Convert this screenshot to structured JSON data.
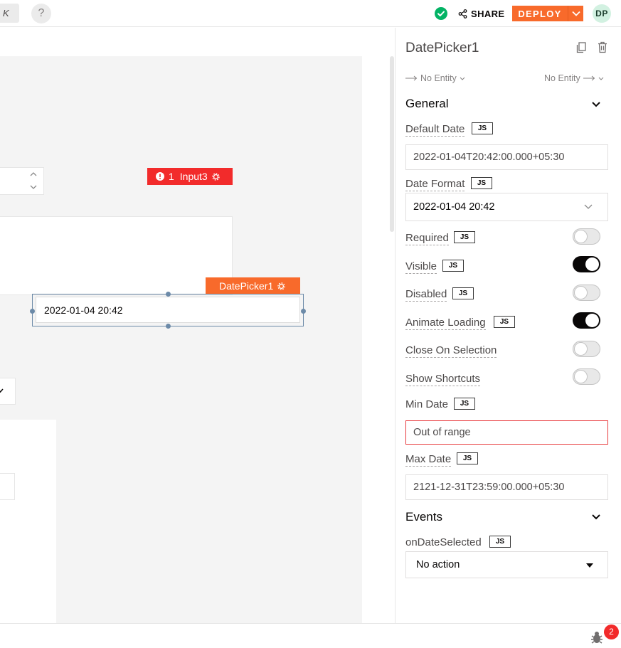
{
  "topbar": {
    "shortcut_hint": "K",
    "help_icon": "?",
    "share_label": "SHARE",
    "deploy_label": "DEPLOY",
    "avatar_initials": "DP"
  },
  "canvas": {
    "input3_error_count": "1",
    "input3_label": "Input3",
    "datepicker_label": "DatePicker1",
    "datepicker_value": "2022-01-04 20:42"
  },
  "pane": {
    "widget_name": "DatePicker1",
    "entity_left": "No Entity",
    "entity_right": "No Entity",
    "general_title": "General",
    "default_date_label": "Default Date",
    "default_date_value": "2022-01-04T20:42:00.000+05:30",
    "date_format_label": "Date Format",
    "date_format_value": "2022-01-04 20:42",
    "required_label": "Required",
    "visible_label": "Visible",
    "disabled_label": "Disabled",
    "animate_loading_label": "Animate Loading",
    "close_on_selection_label": "Close On Selection",
    "show_shortcuts_label": "Show Shortcuts",
    "min_date_label": "Min Date",
    "min_date_value": "Out of range",
    "max_date_label": "Max Date",
    "max_date_value": "2121-12-31T23:59:00.000+05:30",
    "events_title": "Events",
    "on_date_selected_label": "onDateSelected",
    "on_date_selected_value": "No action",
    "js_label": "JS"
  },
  "bottombar": {
    "debug_count": "2"
  },
  "colors": {
    "accent": "#f86a2b",
    "error": "#f22b2b",
    "success": "#03b365",
    "selection": "#6c8aa8"
  }
}
